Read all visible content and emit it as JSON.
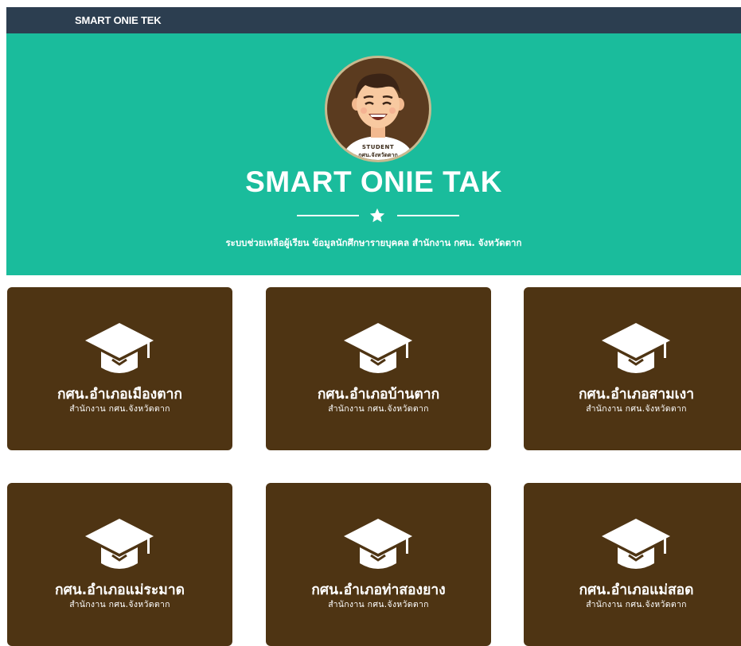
{
  "navbar": {
    "brand": "SMART ONIE TEK"
  },
  "hero": {
    "avatar_badge_top": "STUDENT",
    "avatar_badge_bottom": "กศน.จังหวัดตาก",
    "title": "SMART ONIE TAK",
    "divider_icon": "star-icon",
    "subtitle": "ระบบช่วยเหลือผู้เรียน ข้อมูลนักศึกษารายบุคคล สำนักงาน กศน. จังหวัดตาก"
  },
  "cards": [
    {
      "name": "กศน.อำเภอเมืองตาก",
      "sub": "สำนักงาน กศน.จังหวัดตาก",
      "icon": "graduation-cap-icon"
    },
    {
      "name": "กศน.อำเภอบ้านตาก",
      "sub": "สำนักงาน กศน.จังหวัดตาก",
      "icon": "graduation-cap-icon"
    },
    {
      "name": "กศน.อำเภอสามเงา",
      "sub": "สำนักงาน กศน.จังหวัดตาก",
      "icon": "graduation-cap-icon"
    },
    {
      "name": "กศน.อำเภอแม่ระมาด",
      "sub": "สำนักงาน กศน.จังหวัดตาก",
      "icon": "graduation-cap-icon"
    },
    {
      "name": "กศน.อำเภอท่าสองยาง",
      "sub": "สำนักงาน กศน.จังหวัดตาก",
      "icon": "graduation-cap-icon"
    },
    {
      "name": "กศน.อำเภอแม่สอด",
      "sub": "สำนักงาน กศน.จังหวัดตาก",
      "icon": "graduation-cap-icon"
    }
  ],
  "colors": {
    "navbar": "#2c3e50",
    "masthead": "#1abc9c",
    "card": "#4e3413",
    "text": "#ffffff"
  }
}
